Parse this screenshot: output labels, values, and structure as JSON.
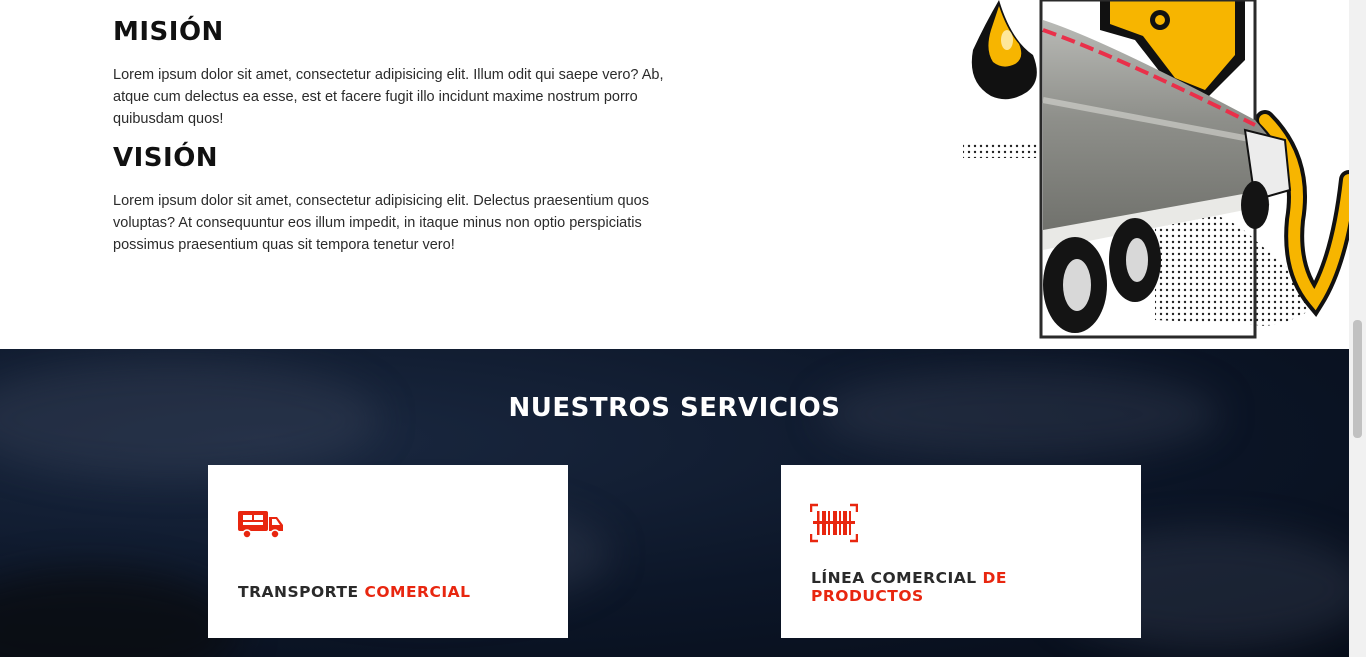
{
  "about": {
    "mission_title": "MISIÓN",
    "mission_text": "Lorem ipsum dolor sit amet, consectetur adipisicing elit. Illum odit qui saepe vero? Ab, atque cum delectus ea esse, est et facere fugit illo incidunt maxime nostrum porro quibusdam quos!",
    "vision_title": "VISIÓN",
    "vision_text": "Lorem ipsum dolor sit amet, consectetur adipisicing elit. Delectus praesentium quos voluptas? At consequuntur eos illum impedit, in itaque minus non optio perspiciatis possimus praesentium quas sit tempora tenetur vero!",
    "image_icon": "tanker-truck-fuel-nozzle-illustration"
  },
  "services": {
    "title": "NUESTROS SERVICIOS",
    "cards": [
      {
        "icon": "truck-icon",
        "title_main": "TRANSPORTE",
        "title_accent": "COMERCIAL"
      },
      {
        "icon": "barcode-scan-icon",
        "title_main": "LÍNEA COMERCIAL",
        "title_accent": "DE PRODUCTOS"
      }
    ]
  },
  "colors": {
    "accent": "#e8260f",
    "dark_bg": "#0c1628",
    "fuel_yellow": "#f7b500"
  }
}
